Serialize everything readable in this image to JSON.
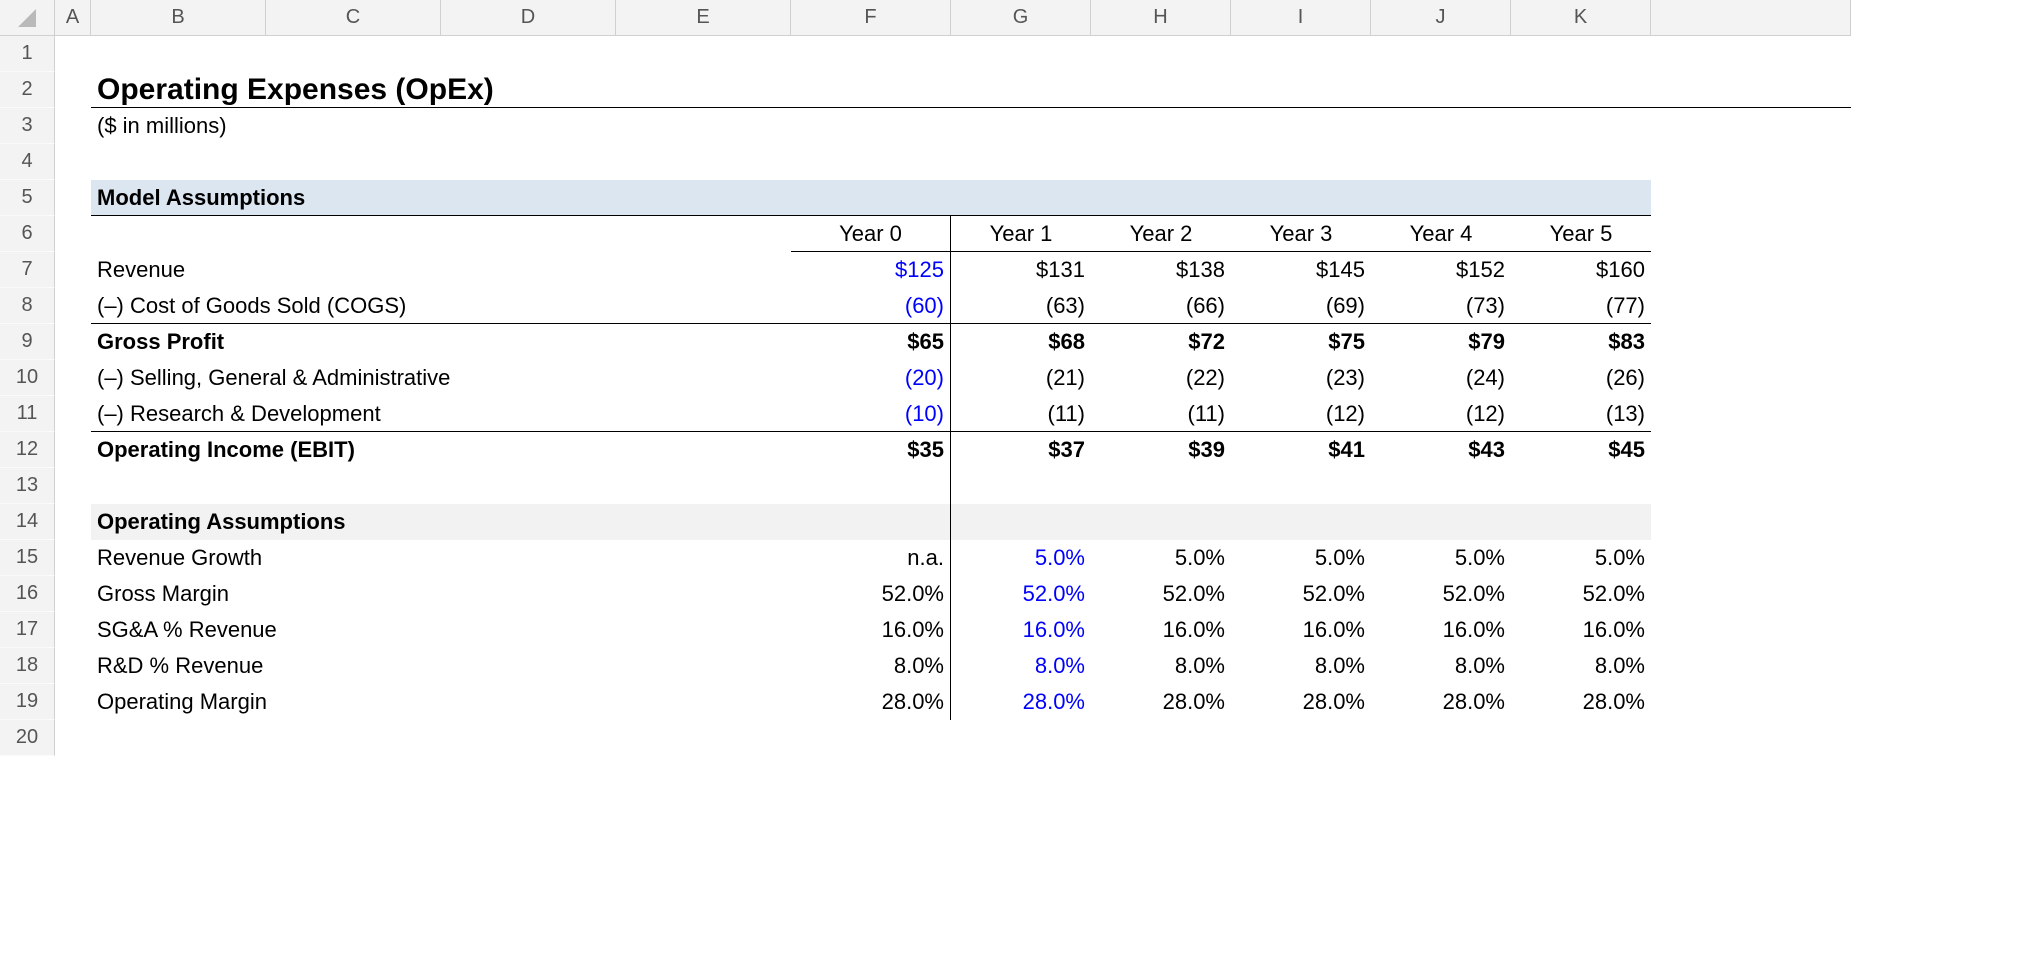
{
  "columns": [
    "A",
    "B",
    "C",
    "D",
    "E",
    "F",
    "G",
    "H",
    "I",
    "J",
    "K"
  ],
  "rowCount": 20,
  "title": "Operating Expenses (OpEx)",
  "subtitle": "($ in millions)",
  "section1": "Model Assumptions",
  "section2": "Operating Assumptions",
  "years": {
    "y0": "Year 0",
    "y1": "Year 1",
    "y2": "Year 2",
    "y3": "Year 3",
    "y4": "Year 4",
    "y5": "Year 5"
  },
  "labels": {
    "revenue": "Revenue",
    "cogs": "(–) Cost of Goods Sold (COGS)",
    "gross": "Gross Profit",
    "sga": "(–) Selling, General & Administrative",
    "rd": "(–) Research & Development",
    "ebit": "Operating Income (EBIT)",
    "revgrowth": "Revenue Growth",
    "grossmargin": "Gross Margin",
    "sgapct": "SG&A % Revenue",
    "rdpct": "R&D % Revenue",
    "opmargin": "Operating Margin"
  },
  "r7": {
    "f": "$125",
    "g": "$131",
    "h": "$138",
    "i": "$145",
    "j": "$152",
    "k": "$160"
  },
  "r8": {
    "f": "(60)",
    "g": "(63)",
    "h": "(66)",
    "i": "(69)",
    "j": "(73)",
    "k": "(77)"
  },
  "r9": {
    "f": "$65",
    "g": "$68",
    "h": "$72",
    "i": "$75",
    "j": "$79",
    "k": "$83"
  },
  "r10": {
    "f": "(20)",
    "g": "(21)",
    "h": "(22)",
    "i": "(23)",
    "j": "(24)",
    "k": "(26)"
  },
  "r11": {
    "f": "(10)",
    "g": "(11)",
    "h": "(11)",
    "i": "(12)",
    "j": "(12)",
    "k": "(13)"
  },
  "r12": {
    "f": "$35",
    "g": "$37",
    "h": "$39",
    "i": "$41",
    "j": "$43",
    "k": "$45"
  },
  "r15": {
    "f": "n.a.",
    "g": "5.0%",
    "h": "5.0%",
    "i": "5.0%",
    "j": "5.0%",
    "k": "5.0%"
  },
  "r16": {
    "f": "52.0%",
    "g": "52.0%",
    "h": "52.0%",
    "i": "52.0%",
    "j": "52.0%",
    "k": "52.0%"
  },
  "r17": {
    "f": "16.0%",
    "g": "16.0%",
    "h": "16.0%",
    "i": "16.0%",
    "j": "16.0%",
    "k": "16.0%"
  },
  "r18": {
    "f": "8.0%",
    "g": "8.0%",
    "h": "8.0%",
    "i": "8.0%",
    "j": "8.0%",
    "k": "8.0%"
  },
  "r19": {
    "f": "28.0%",
    "g": "28.0%",
    "h": "28.0%",
    "i": "28.0%",
    "j": "28.0%",
    "k": "28.0%"
  }
}
